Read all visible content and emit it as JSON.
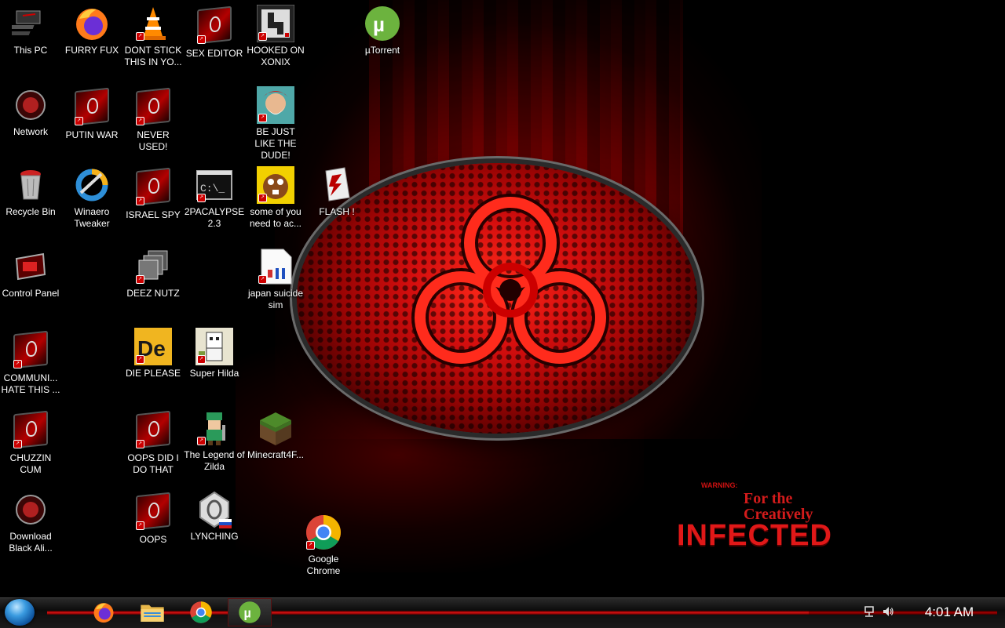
{
  "desktop": {
    "wallpaper": {
      "warning": "WARNING:",
      "tagline": "For the Creatively",
      "headline": "INFECTED"
    },
    "icons": [
      {
        "id": "this-pc",
        "label": "This PC"
      },
      {
        "id": "furry-fux",
        "label": "FURRY FUX"
      },
      {
        "id": "dont-stick",
        "label": "DONT STICK THIS IN YO..."
      },
      {
        "id": "sex-editor",
        "label": "SEX EDITOR"
      },
      {
        "id": "hooked-on-xonix",
        "label": "HOOKED ON XONIX"
      },
      {
        "id": "utorrent",
        "label": "µTorrent"
      },
      {
        "id": "network",
        "label": "Network"
      },
      {
        "id": "putin-war",
        "label": "PUTIN WAR"
      },
      {
        "id": "never-used",
        "label": "NEVER USED!"
      },
      {
        "id": "be-just-like-the-dude",
        "label": "BE JUST LIKE THE DUDE!"
      },
      {
        "id": "recycle-bin",
        "label": "Recycle Bin"
      },
      {
        "id": "winaero-tweaker",
        "label": "Winaero Tweaker"
      },
      {
        "id": "israel-spy",
        "label": "ISRAEL SPY"
      },
      {
        "id": "2pacalypse",
        "label": "2PACALYPSE 2.3"
      },
      {
        "id": "some-of-you",
        "label": "some of you need to ac..."
      },
      {
        "id": "flash",
        "label": "FLASH !"
      },
      {
        "id": "control-panel",
        "label": "Control Panel"
      },
      {
        "id": "deez-nutz",
        "label": "DEEZ NUTZ"
      },
      {
        "id": "japan-suicide-sim",
        "label": "japan suicide sim"
      },
      {
        "id": "communi-hate",
        "label": "COMMUNI... HATE THIS ..."
      },
      {
        "id": "die-please",
        "label": "DIE PLEASE"
      },
      {
        "id": "super-hilda",
        "label": "Super Hilda"
      },
      {
        "id": "chuzzin-cum",
        "label": "CHUZZIN CUM"
      },
      {
        "id": "oops-did-i-do-that",
        "label": "OOPS DID I DO THAT"
      },
      {
        "id": "legend-of-zilda",
        "label": "The Legend of Zilda"
      },
      {
        "id": "minecraft",
        "label": "Minecraft4F..."
      },
      {
        "id": "download-black-ali",
        "label": "Download Black Ali..."
      },
      {
        "id": "oops",
        "label": "OOPS"
      },
      {
        "id": "lynching",
        "label": "LYNCHING"
      },
      {
        "id": "google-chrome",
        "label": "Google Chrome"
      }
    ]
  },
  "taskbar": {
    "pinned": [
      {
        "name": "firefox-icon"
      },
      {
        "name": "file-explorer-icon"
      },
      {
        "name": "chrome-icon"
      },
      {
        "name": "utorrent-icon",
        "active": true
      }
    ],
    "tray": [
      "network-icon",
      "volume-icon"
    ],
    "clock": "4:01 AM"
  },
  "colors": {
    "accent": "#d11111",
    "desktop_bg": "#000000"
  }
}
